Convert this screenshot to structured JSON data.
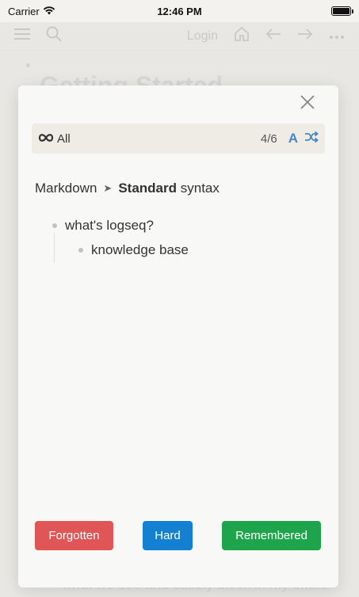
{
  "status_bar": {
    "carrier": "Carrier",
    "time": "12:46 PM"
  },
  "background": {
    "nav": {
      "login": "Login"
    },
    "page_title": "Getting Started",
    "bottom_text": "what we see and satisfy block in my entire"
  },
  "modal": {
    "filter_label": "All",
    "count": "4/6",
    "font_toggle_label": "A",
    "breadcrumb": {
      "parent": "Markdown",
      "current_bold": "Standard",
      "current_rest": "syntax"
    },
    "blocks": [
      {
        "text": "what's logseq?"
      },
      {
        "text": "knowledge base"
      }
    ],
    "buttons": {
      "forgotten": "Forgotten",
      "hard": "Hard",
      "remembered": "Remembered"
    }
  },
  "colors": {
    "forgotten": "#e05656",
    "hard": "#1380d1",
    "remembered": "#1ea44a",
    "accent": "#4a86c5"
  },
  "icons": [
    "wifi-icon",
    "battery-icon",
    "menu-icon",
    "search-icon",
    "home-icon",
    "arrow-left-icon",
    "arrow-right-icon",
    "more-icon",
    "close-icon",
    "infinity-icon",
    "shuffle-icon"
  ]
}
